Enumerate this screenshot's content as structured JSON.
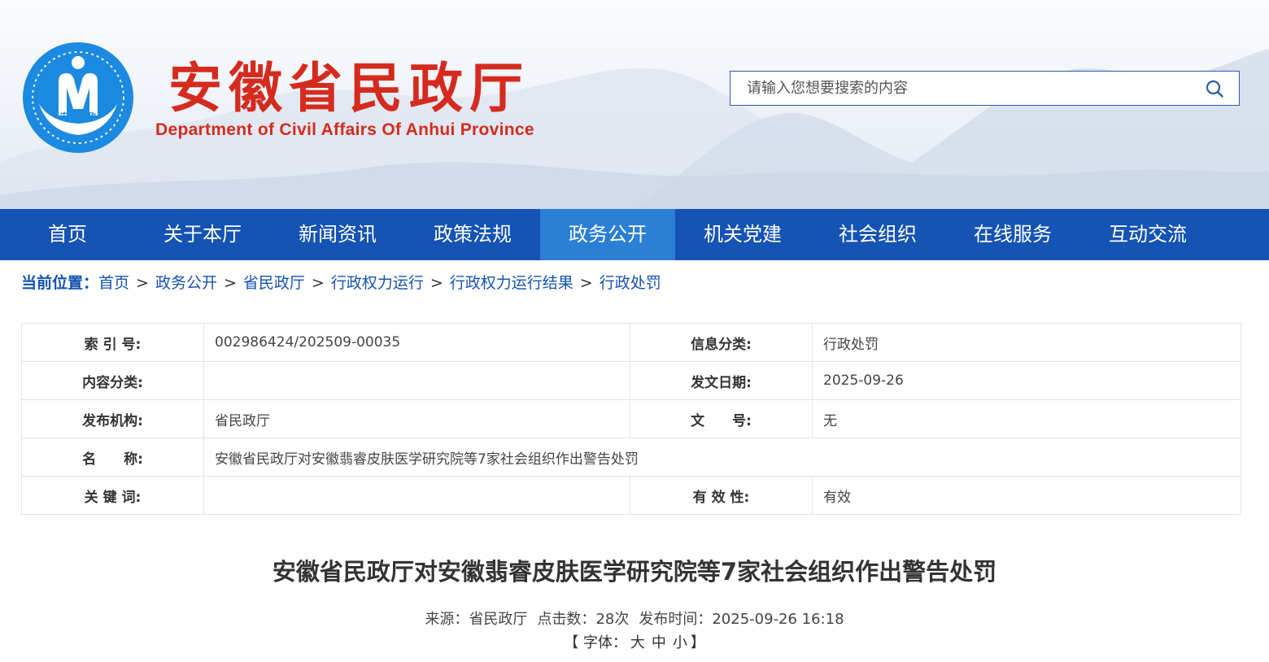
{
  "header": {
    "logo_text": "安徽民政",
    "title": "安徽省民政厅",
    "subtitle": "Department of Civil Affairs Of Anhui Province",
    "search_placeholder": "请输入您想要搜索的内容",
    "search_icon": "search-icon"
  },
  "nav": {
    "items": [
      {
        "label": "首页"
      },
      {
        "label": "关于本厅"
      },
      {
        "label": "新闻资讯"
      },
      {
        "label": "政策法规"
      },
      {
        "label": "政务公开",
        "active": true
      },
      {
        "label": "机关党建"
      },
      {
        "label": "社会组织"
      },
      {
        "label": "在线服务"
      },
      {
        "label": "互动交流"
      }
    ]
  },
  "breadcrumb": {
    "label": "当前位置：",
    "items": [
      "首页",
      "政务公开",
      "省民政厅",
      "行政权力运行",
      "行政权力运行结果",
      "行政处罚"
    ],
    "separator": ">"
  },
  "meta": {
    "index_label": "索 引 号:",
    "index_value": "002986424/202509-00035",
    "category_label": "信息分类:",
    "category_value": "行政处罚",
    "content_type_label": "内容分类:",
    "content_type_value": "",
    "date_label": "发文日期:",
    "date_value": "2025-09-26",
    "publisher_label": "发布机构:",
    "publisher_value": "省民政厅",
    "doc_no_label": "文　　号:",
    "doc_no_value": "无",
    "name_label": "名　　称:",
    "name_value": "安徽省民政厅对安徽翡睿皮肤医学研究院等7家社会组织作出警告处罚",
    "keywords_label": "关 键 词:",
    "keywords_value": "",
    "validity_label": "有 效 性:",
    "validity_value": "有效"
  },
  "article": {
    "title": "安徽省民政厅对安徽翡睿皮肤医学研究院等7家社会组织作出警告处罚",
    "source_label": "来源：",
    "source": "省民政厅",
    "clicks_label": "点击数：",
    "clicks": "28次",
    "time_label": "发布时间：",
    "time": "2025-09-26 16:18",
    "font_bracket_open": "【 字体：",
    "font_large": "大",
    "font_medium": "中",
    "font_small": "小",
    "font_bracket_close": "】"
  },
  "colors": {
    "brand_red": "#d52b1e",
    "nav_blue": "#1553b4",
    "nav_active": "#2b7fd5",
    "logo_blue": "#1c8ae0"
  }
}
